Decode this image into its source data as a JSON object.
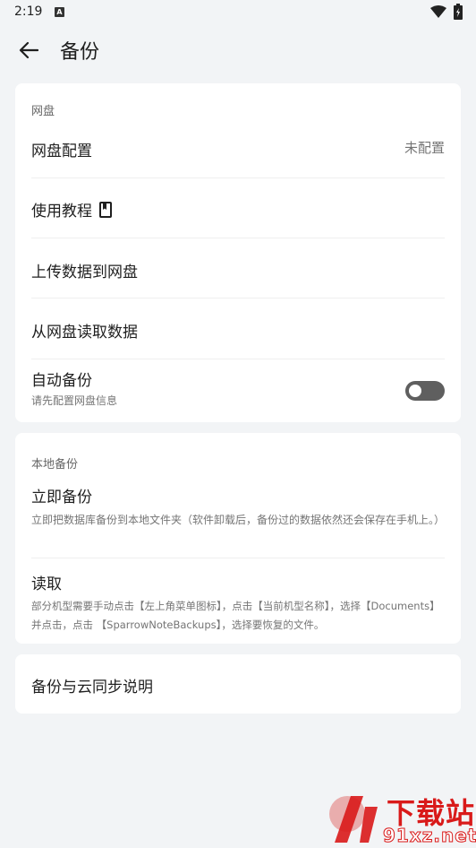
{
  "status_bar": {
    "time": "2:19"
  },
  "app_bar": {
    "title": "备份"
  },
  "cloud_section": {
    "header": "网盘",
    "items": [
      {
        "title": "网盘配置",
        "value": "未配置"
      },
      {
        "title": "使用教程"
      },
      {
        "title": "上传数据到网盘"
      },
      {
        "title": "从网盘读取数据"
      },
      {
        "title": "自动备份",
        "subtitle": "请先配置网盘信息",
        "toggle_on": false
      }
    ]
  },
  "local_section": {
    "header": "本地备份",
    "items": [
      {
        "title": "立即备份",
        "subtitle": "立即把数据库备份到本地文件夹（软件卸载后，备份过的数据依然还会保存在手机上。）"
      },
      {
        "title": "读取",
        "subtitle": "部分机型需要手动点击【左上角菜单图标】，点击【当前机型名称】，选择【Documents】 并点击，点击 【SparrowNoteBackups】，选择要恢复的文件。"
      }
    ]
  },
  "help_section": {
    "title": "备份与云同步说明"
  },
  "watermark": {
    "top_text": "下载站",
    "bottom_text": "91xz.net"
  },
  "colors": {
    "background": "#f2f4f6",
    "card": "#ffffff",
    "toggle_off": "#5f5f5f",
    "watermark_red": "#d91a1a"
  }
}
